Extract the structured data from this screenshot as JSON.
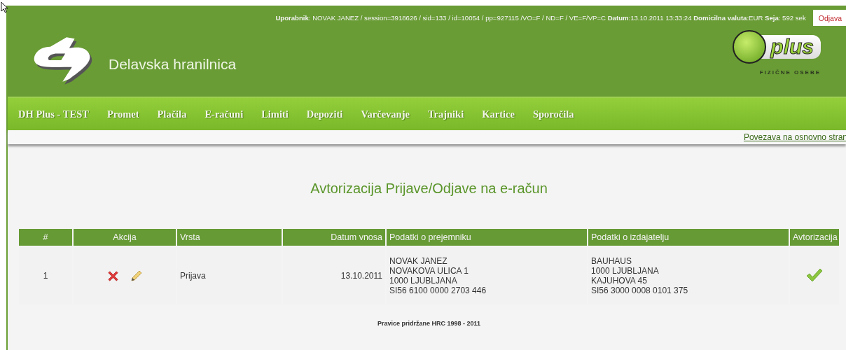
{
  "header": {
    "info": "**Uporabnik**: NOVAK JANEZ  / session=3918626 / sid=133 / id=10054 / pp=927115 /VO=F / ND=F / VE=F/VP=C **Datum**:13.10.2011 13:33:24 **Domicilna valuta**:EUR  **Seja**: 592 sek",
    "logout": "Odjava",
    "bank_name": "Delavska hranilnica",
    "badge_text": "plus",
    "badge_caption": "FIZIČNE OSEBE"
  },
  "nav": [
    {
      "label": "DH Plus - TEST"
    },
    {
      "label": "Promet"
    },
    {
      "label": "Plačila"
    },
    {
      "label": "E-računi"
    },
    {
      "label": "Limiti"
    },
    {
      "label": "Depoziti"
    },
    {
      "label": "Varčevanje"
    },
    {
      "label": "Trajniki"
    },
    {
      "label": "Kartice"
    },
    {
      "label": "Sporočila"
    }
  ],
  "sublink": "Povezava na osnovno stran",
  "title": "Avtorizacija Prijave/Odjave na e-račun",
  "table": {
    "columns": [
      "#",
      "Akcija",
      "Vrsta",
      "Datum vnosa",
      "Podatki o prejemniku",
      "Podatki o izdajatelju",
      "Avtorizacija"
    ],
    "rows": [
      {
        "number": "1",
        "type": "Prijava",
        "date": "13.10.2011",
        "recipient": [
          "NOVAK JANEZ",
          "NOVAKOVA ULICA 1",
          "1000 LJUBLJANA",
          "SI56 6100 0000 2703 446"
        ],
        "issuer": [
          "BAUHAUS",
          "1000 LJUBLJANA",
          "KAJUHOVA 45",
          "SI56 3000 0008 0101 375"
        ],
        "authorized": true
      }
    ]
  },
  "footer": "Pravice pridržane HRC 1998 - 2011"
}
